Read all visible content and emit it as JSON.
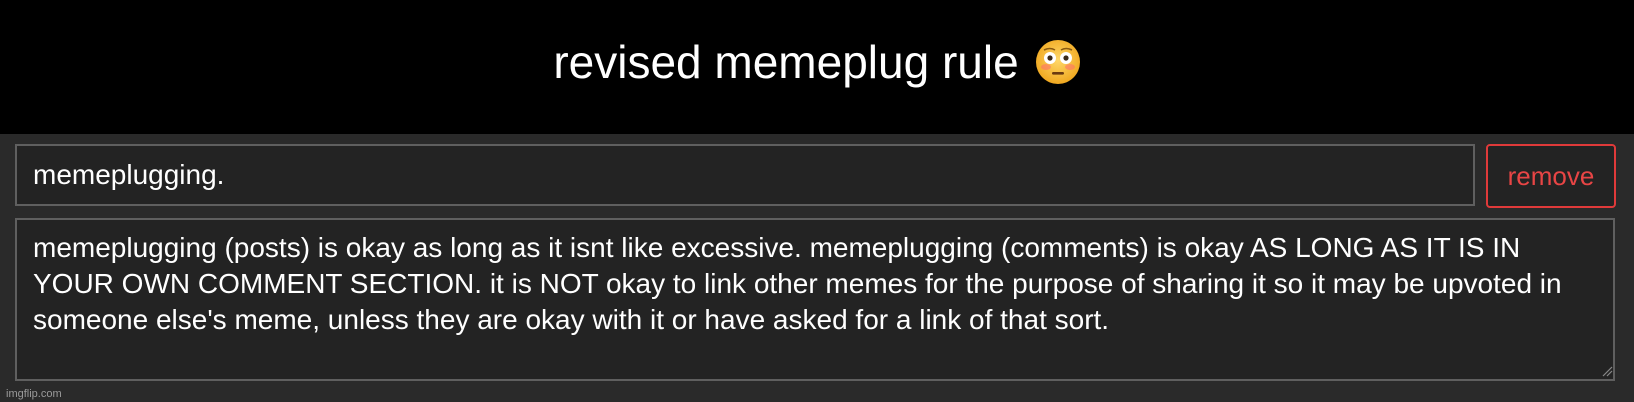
{
  "header": {
    "title": "revised memeplug rule",
    "emoji_icon": "flushed-face-icon"
  },
  "rule": {
    "name_value": "memeplugging.",
    "remove_label": "remove",
    "description": "memeplugging (posts) is okay as long as it isnt like excessive. memeplugging (comments) is okay AS LONG AS IT IS IN YOUR OWN COMMENT SECTION. it is NOT okay to link other memes for the purpose of sharing it so it may be upvoted in someone else's meme, unless they are okay with it or have asked for a link of that sort."
  },
  "watermark": "imgflip.com",
  "colors": {
    "header_bg": "#000000",
    "panel_bg": "#2a2a2a",
    "field_bg": "#232323",
    "field_border": "#5f5f5f",
    "remove_red": "#e84545"
  }
}
